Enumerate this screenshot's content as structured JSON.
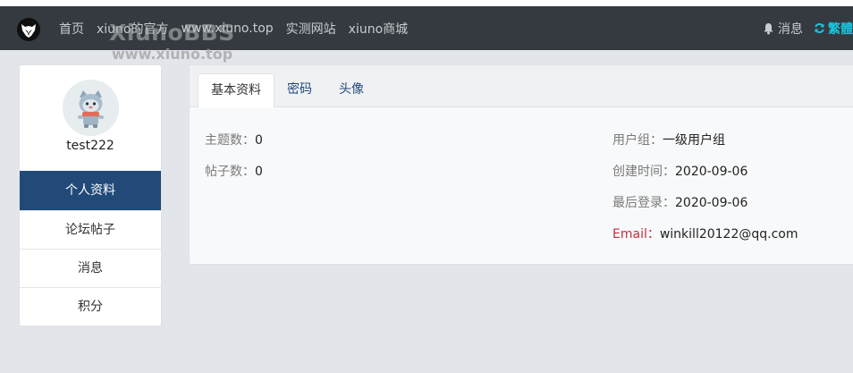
{
  "navbar": {
    "links": [
      "首页",
      "xiuno的官方",
      "www.xiuno.top",
      "实测网站",
      "xiuno商城"
    ],
    "watermark_title": "XiunoBBS",
    "watermark_url": "www.xiuno.top",
    "messages_label": "消息",
    "traditional_label": "繁體"
  },
  "sidebar": {
    "username": "test222",
    "items": [
      {
        "label": "个人资料",
        "active": true
      },
      {
        "label": "论坛帖子",
        "active": false
      },
      {
        "label": "消息",
        "active": false
      },
      {
        "label": "积分",
        "active": false
      }
    ]
  },
  "tabs": [
    {
      "label": "基本资料",
      "active": true
    },
    {
      "label": "密码",
      "active": false
    },
    {
      "label": "头像",
      "active": false
    }
  ],
  "profile": {
    "threads": {
      "label": "主题数：",
      "value": "0"
    },
    "posts": {
      "label": "帖子数：",
      "value": "0"
    },
    "group": {
      "label": "用户组：",
      "value": "一级用户组"
    },
    "created": {
      "label": "创建时间：",
      "value": "2020-09-06"
    },
    "last_login": {
      "label": "最后登录：",
      "value": "2020-09-06"
    },
    "email": {
      "label": "Email：",
      "value": "winkill20122@qq.com"
    }
  },
  "colors": {
    "navbar": "#343a40",
    "accent": "#214a79",
    "traditional_link": "#17c5de",
    "email_label": "#c0303f"
  },
  "icons": {
    "logo": "site-logo-icon",
    "bell": "bell-icon",
    "refresh": "refresh-icon"
  }
}
